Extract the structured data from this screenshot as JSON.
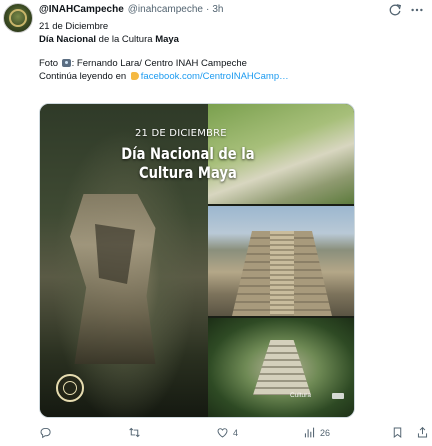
{
  "tweet": {
    "display_name": "@INAHCampeche",
    "handle": "@inahcampeche",
    "dot": "·",
    "time": "3h",
    "icons": {
      "grok": "grok-icon",
      "more": "more-icon"
    },
    "text": {
      "line1": "21 de Diciembre",
      "line2_bold1": "Día Nacional",
      "line2_mid": " de la Cultura ",
      "line2_bold2": "Maya",
      "line3_prefix": "Foto ",
      "line3_rest": ": Fernando Lara/ Centro INAH Campeche",
      "line4_prefix": "Continúa leyendo en ",
      "line4_link": "facebook.com/CentroINAHCamp…"
    },
    "media": {
      "date_text": "21 DE DICIEMBRE",
      "title_line1": "Día Nacional de la",
      "title_line2": "Cultura Maya",
      "logo_text": "Cultura"
    },
    "actions": {
      "reply_count": "",
      "retweet_count": "",
      "like_count": "4",
      "views_count": "26"
    }
  }
}
